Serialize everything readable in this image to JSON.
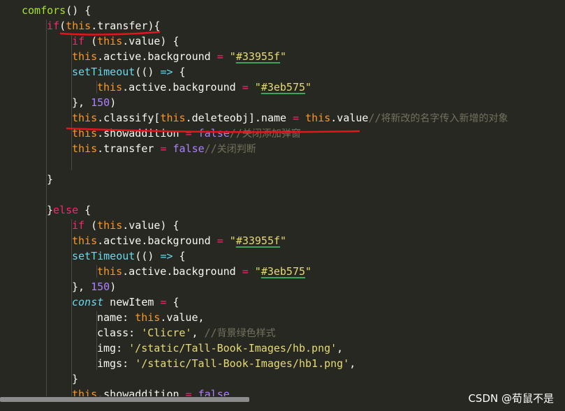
{
  "code_lines": [
    {
      "indent": 0,
      "tokens": [
        {
          "c": "fn",
          "t": "comfors"
        },
        {
          "c": "plain",
          "t": "() {"
        }
      ]
    },
    {
      "indent": 1,
      "tokens": [
        {
          "c": "kw",
          "t": "if"
        },
        {
          "c": "plain",
          "t": "("
        },
        {
          "c": "this",
          "t": "this"
        },
        {
          "c": "plain",
          "t": ".transfer){"
        }
      ]
    },
    {
      "indent": 2,
      "tokens": [
        {
          "c": "kw",
          "t": "if"
        },
        {
          "c": "plain",
          "t": " ("
        },
        {
          "c": "this",
          "t": "this"
        },
        {
          "c": "plain",
          "t": ".value) {"
        }
      ]
    },
    {
      "indent": 2,
      "tokens": [
        {
          "c": "this",
          "t": "this"
        },
        {
          "c": "plain",
          "t": ".active.background "
        },
        {
          "c": "kw",
          "t": "="
        },
        {
          "c": "plain",
          "t": " "
        },
        {
          "c": "str",
          "t": "\""
        },
        {
          "c": "hex",
          "t": "#33955f"
        },
        {
          "c": "str",
          "t": "\""
        }
      ]
    },
    {
      "indent": 2,
      "tokens": [
        {
          "c": "call",
          "t": "setTimeout"
        },
        {
          "c": "plain",
          "t": "(() "
        },
        {
          "c": "arrow",
          "t": "=>"
        },
        {
          "c": "plain",
          "t": " {"
        }
      ]
    },
    {
      "indent": 3,
      "tokens": [
        {
          "c": "this",
          "t": "this"
        },
        {
          "c": "plain",
          "t": ".active.background "
        },
        {
          "c": "kw",
          "t": "="
        },
        {
          "c": "plain",
          "t": " "
        },
        {
          "c": "str",
          "t": "\""
        },
        {
          "c": "hex",
          "t": "#3eb575"
        },
        {
          "c": "str",
          "t": "\""
        }
      ]
    },
    {
      "indent": 2,
      "tokens": [
        {
          "c": "plain",
          "t": "}, "
        },
        {
          "c": "num",
          "t": "150"
        },
        {
          "c": "plain",
          "t": ")"
        }
      ]
    },
    {
      "indent": 2,
      "tokens": [
        {
          "c": "this",
          "t": "this"
        },
        {
          "c": "plain",
          "t": ".classify["
        },
        {
          "c": "this",
          "t": "this"
        },
        {
          "c": "plain",
          "t": ".deleteobj].name "
        },
        {
          "c": "kw",
          "t": "="
        },
        {
          "c": "plain",
          "t": " "
        },
        {
          "c": "this",
          "t": "this"
        },
        {
          "c": "plain",
          "t": ".value"
        },
        {
          "c": "cm",
          "t": "//"
        },
        {
          "c": "cmcn",
          "t": "将新改的名字传入新增的对象"
        }
      ]
    },
    {
      "indent": 2,
      "tokens": [
        {
          "c": "this",
          "t": "this"
        },
        {
          "c": "plain",
          "t": ".showaddition "
        },
        {
          "c": "kw",
          "t": "="
        },
        {
          "c": "plain",
          "t": " "
        },
        {
          "c": "bool",
          "t": "false"
        },
        {
          "c": "cm",
          "t": "//"
        },
        {
          "c": "cmcn",
          "t": "关闭添加弹窗"
        }
      ]
    },
    {
      "indent": 2,
      "tokens": [
        {
          "c": "this",
          "t": "this"
        },
        {
          "c": "plain",
          "t": ".transfer "
        },
        {
          "c": "kw",
          "t": "="
        },
        {
          "c": "plain",
          "t": " "
        },
        {
          "c": "bool",
          "t": "false"
        },
        {
          "c": "cm",
          "t": "//"
        },
        {
          "c": "cmcn",
          "t": "关闭判断"
        }
      ]
    },
    {
      "indent": 0,
      "tokens": []
    },
    {
      "indent": 1,
      "tokens": [
        {
          "c": "plain",
          "t": "}"
        }
      ]
    },
    {
      "indent": 0,
      "tokens": []
    },
    {
      "indent": 1,
      "tokens": [
        {
          "c": "plain",
          "t": "}"
        },
        {
          "c": "kw",
          "t": "else"
        },
        {
          "c": "plain",
          "t": " {"
        }
      ]
    },
    {
      "indent": 2,
      "tokens": [
        {
          "c": "kw",
          "t": "if"
        },
        {
          "c": "plain",
          "t": " ("
        },
        {
          "c": "this",
          "t": "this"
        },
        {
          "c": "plain",
          "t": ".value) {"
        }
      ]
    },
    {
      "indent": 2,
      "tokens": [
        {
          "c": "this",
          "t": "this"
        },
        {
          "c": "plain",
          "t": ".active.background "
        },
        {
          "c": "kw",
          "t": "="
        },
        {
          "c": "plain",
          "t": " "
        },
        {
          "c": "str",
          "t": "\""
        },
        {
          "c": "hex",
          "t": "#33955f"
        },
        {
          "c": "str",
          "t": "\""
        }
      ]
    },
    {
      "indent": 2,
      "tokens": [
        {
          "c": "call",
          "t": "setTimeout"
        },
        {
          "c": "plain",
          "t": "(() "
        },
        {
          "c": "arrow",
          "t": "=>"
        },
        {
          "c": "plain",
          "t": " {"
        }
      ]
    },
    {
      "indent": 3,
      "tokens": [
        {
          "c": "this",
          "t": "this"
        },
        {
          "c": "plain",
          "t": ".active.background "
        },
        {
          "c": "kw",
          "t": "="
        },
        {
          "c": "plain",
          "t": " "
        },
        {
          "c": "str",
          "t": "\""
        },
        {
          "c": "hex",
          "t": "#3eb575"
        },
        {
          "c": "str",
          "t": "\""
        }
      ]
    },
    {
      "indent": 2,
      "tokens": [
        {
          "c": "plain",
          "t": "}, "
        },
        {
          "c": "num",
          "t": "150"
        },
        {
          "c": "plain",
          "t": ")"
        }
      ]
    },
    {
      "indent": 2,
      "tokens": [
        {
          "c": "decl",
          "t": "const"
        },
        {
          "c": "plain",
          "t": " newItem "
        },
        {
          "c": "kw",
          "t": "="
        },
        {
          "c": "plain",
          "t": " {"
        }
      ]
    },
    {
      "indent": 3,
      "tokens": [
        {
          "c": "plain",
          "t": "name: "
        },
        {
          "c": "this",
          "t": "this"
        },
        {
          "c": "plain",
          "t": ".value,"
        }
      ]
    },
    {
      "indent": 3,
      "tokens": [
        {
          "c": "plain",
          "t": "class: "
        },
        {
          "c": "str",
          "t": "'Clicre'"
        },
        {
          "c": "plain",
          "t": ", "
        },
        {
          "c": "cm",
          "t": "//"
        },
        {
          "c": "cmcn",
          "t": "背景绿色样式"
        }
      ]
    },
    {
      "indent": 3,
      "tokens": [
        {
          "c": "plain",
          "t": "img: "
        },
        {
          "c": "str",
          "t": "'/static/Tall-Book-Images/hb.png'"
        },
        {
          "c": "plain",
          "t": ","
        }
      ]
    },
    {
      "indent": 3,
      "tokens": [
        {
          "c": "plain",
          "t": "imgs: "
        },
        {
          "c": "str",
          "t": "'/static/Tall-Book-Images/hb1.png'"
        },
        {
          "c": "plain",
          "t": ","
        }
      ]
    },
    {
      "indent": 2,
      "tokens": [
        {
          "c": "plain",
          "t": "}"
        }
      ]
    },
    {
      "indent": 2,
      "tokens": [
        {
          "c": "this",
          "t": "this"
        },
        {
          "c": "plain",
          "t": ".showaddition "
        },
        {
          "c": "kw",
          "t": "="
        },
        {
          "c": "plain",
          "t": " "
        },
        {
          "c": "bool",
          "t": "false"
        }
      ]
    }
  ],
  "watermark": "CSDN @荀鼠不是",
  "colors": {
    "background": "#272822",
    "annotation_red": "#e8141b",
    "hex_underline": "#3ba55b",
    "scroll_thumb": "#8c8c8c"
  }
}
